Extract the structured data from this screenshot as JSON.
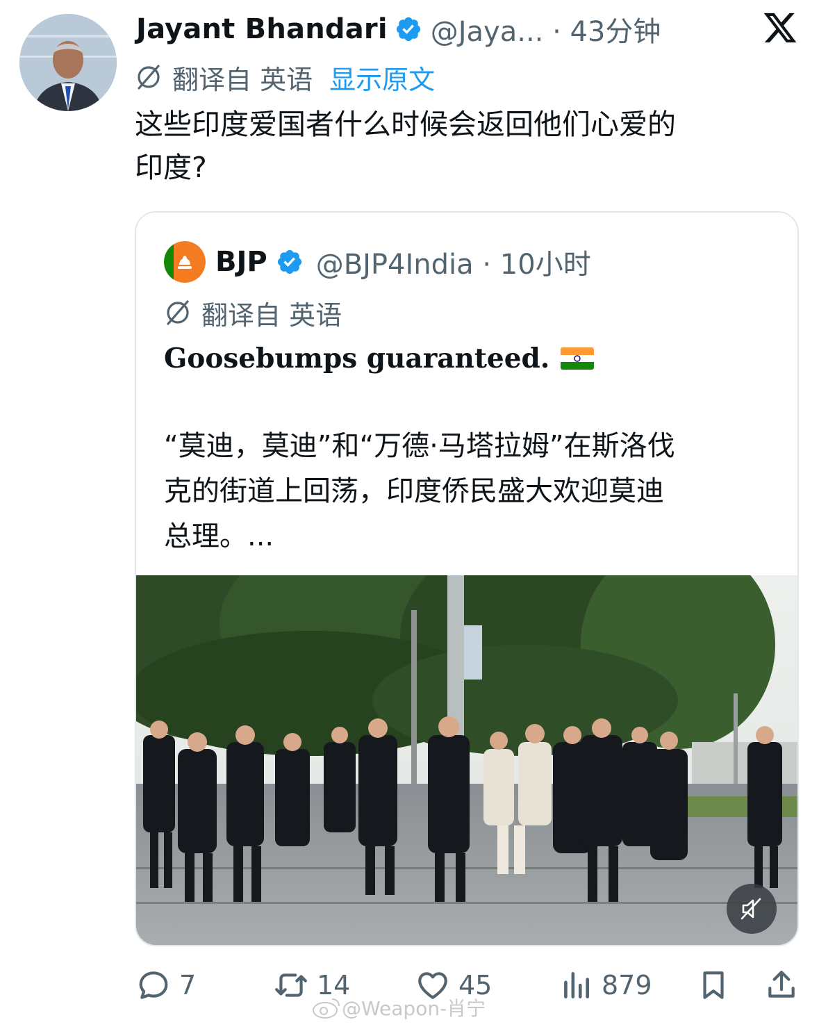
{
  "author": {
    "name": "Jayant Bhandari",
    "handle_time": "@Jaya... · 43分钟"
  },
  "translation": {
    "label": "翻译自 英语",
    "show_original": "显示原文"
  },
  "tweet": {
    "lines": [
      "这些印度爱国者什么时候会返回他们心爱的",
      "印度?"
    ]
  },
  "quote": {
    "name": "BJP",
    "handle_time": "@BJP4India · 10小时",
    "translation_label": "翻译自 英语",
    "title": "Goosebumps guaranteed.",
    "lines": [
      "“莫迪，莫迪”和“万德·马塔拉姆”在斯洛伐",
      "克的街道上回荡，印度侨民盛大欢迎莫迪",
      "总理。..."
    ]
  },
  "actions": {
    "replies": "7",
    "reposts": "14",
    "likes": "45",
    "views": "879"
  },
  "watermark": "@Weapon-肖宁",
  "colors": {
    "text_primary": "#0f1419",
    "text_secondary": "#536471",
    "link_blue": "#1d9bf0",
    "border": "#e1e8ed"
  }
}
